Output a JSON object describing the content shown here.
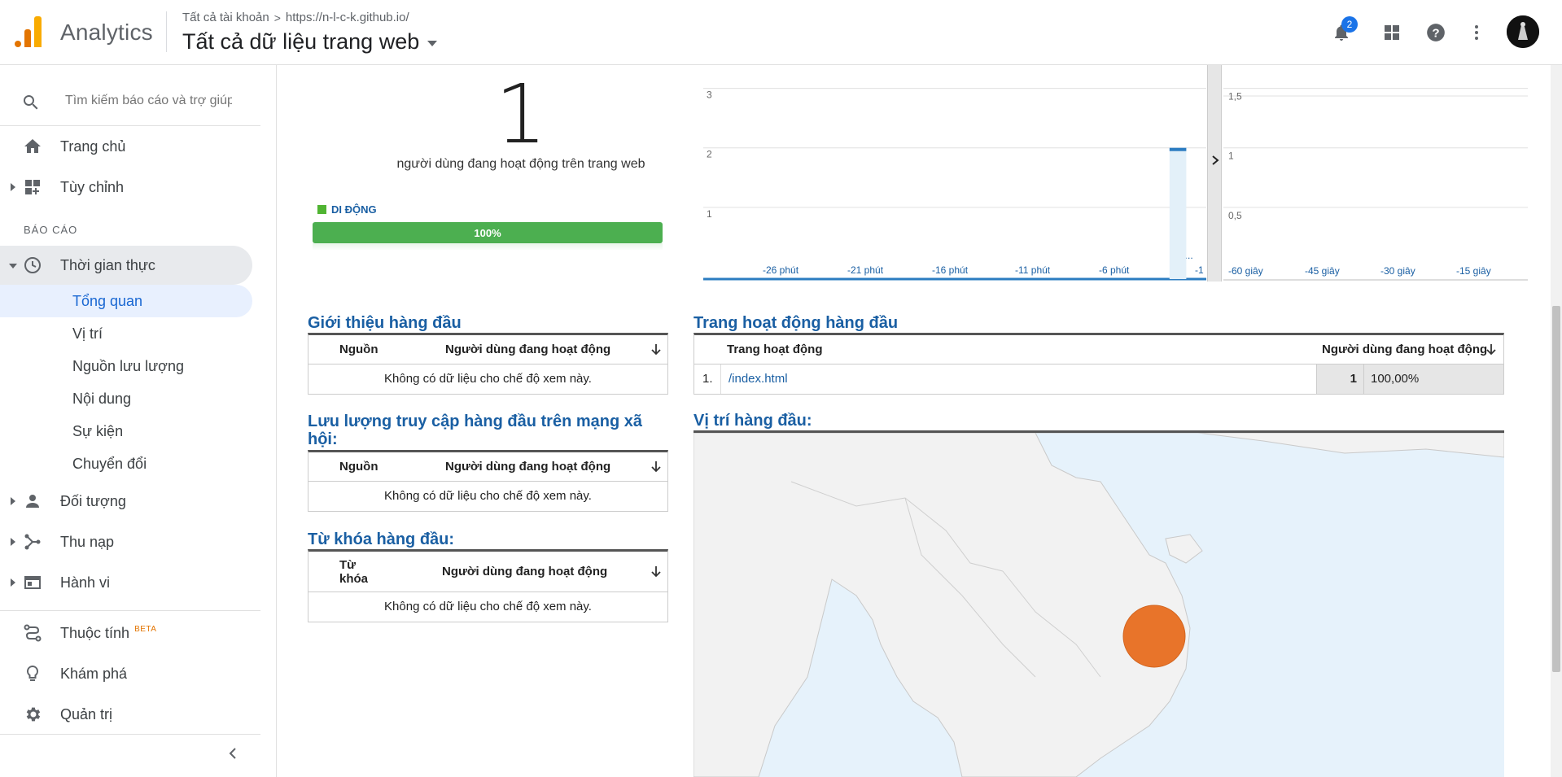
{
  "header": {
    "app_name": "Analytics",
    "breadcrumb_account": "Tất cả tài khoản",
    "breadcrumb_sep": ">",
    "breadcrumb_property": "https://n-l-c-k.github.io/",
    "view_title": "Tất cả dữ liệu trang web",
    "notification_count": "2",
    "icons": [
      "bell-icon",
      "apps-icon",
      "help-icon",
      "more-vert-icon",
      "avatar"
    ]
  },
  "sidebar": {
    "search_placeholder": "Tìm kiếm báo cáo và trợ giúp",
    "home": "Trang chủ",
    "customize": "Tùy chỉnh",
    "reports_label": "BÁO CÁO",
    "realtime": "Thời gian thực",
    "realtime_sub": [
      "Tổng quan",
      "Vị trí",
      "Nguồn lưu lượng",
      "Nội dung",
      "Sự kiện",
      "Chuyển đổi"
    ],
    "audience": "Đối tượng",
    "acquisition": "Thu nạp",
    "behavior": "Hành vi",
    "attribution": "Thuộc tính",
    "attribution_badge": "BETA",
    "discover": "Khám phá",
    "admin": "Quản trị"
  },
  "overview": {
    "active_users": "1",
    "active_caption": "người dùng đang hoạt động trên trang web",
    "device_label": "DI ĐỘNG",
    "device_percent_label": "100%",
    "device_fraction": 1.0,
    "colors": {
      "device_bar": "#4caf50",
      "accent_blue": "#1a5fa3",
      "map_marker": "#e8742a"
    }
  },
  "chart_data": [
    {
      "type": "bar",
      "x_tick_labels": [
        "-26 phút",
        "-21 phút",
        "-16 phút",
        "-11 phút",
        "-6 phút",
        "p...",
        "-1"
      ],
      "y_ticks": [
        "1",
        "2",
        "3"
      ],
      "series": [
        {
          "values": [
            {
              "x": -2,
              "y": 2
            }
          ]
        }
      ],
      "ylim": [
        0,
        3.5
      ]
    },
    {
      "type": "bar",
      "x_tick_labels": [
        "-60 giây",
        "-45 giây",
        "-30 giây",
        "-15 giây"
      ],
      "y_ticks": [
        "0,5",
        "1",
        "1,5"
      ],
      "series": [
        {
          "values": []
        }
      ],
      "ylim": [
        0,
        1.75
      ]
    }
  ],
  "top_referrals": {
    "title": "Giới thiệu hàng đầu",
    "col1": "Nguồn",
    "col2": "Người dùng đang hoạt động",
    "empty": "Không có dữ liệu cho chế độ xem này."
  },
  "top_social": {
    "title": "Lưu lượng truy cập hàng đầu trên mạng xã hội:",
    "col1": "Nguồn",
    "col2": "Người dùng đang hoạt động",
    "empty": "Không có dữ liệu cho chế độ xem này."
  },
  "top_keywords": {
    "title": "Từ khóa hàng đầu:",
    "col1": "Từ khóa",
    "col2": "Người dùng đang hoạt động",
    "empty": "Không có dữ liệu cho chế độ xem này."
  },
  "top_pages": {
    "title": "Trang hoạt động hàng đầu",
    "col1": "Trang hoạt động",
    "col2": "Người dùng đang hoạt động",
    "rows": [
      {
        "index": "1.",
        "page": "/index.html",
        "users": "1",
        "percent": "100,00%"
      }
    ]
  },
  "top_locations": {
    "title": "Vị trí hàng đầu:"
  }
}
